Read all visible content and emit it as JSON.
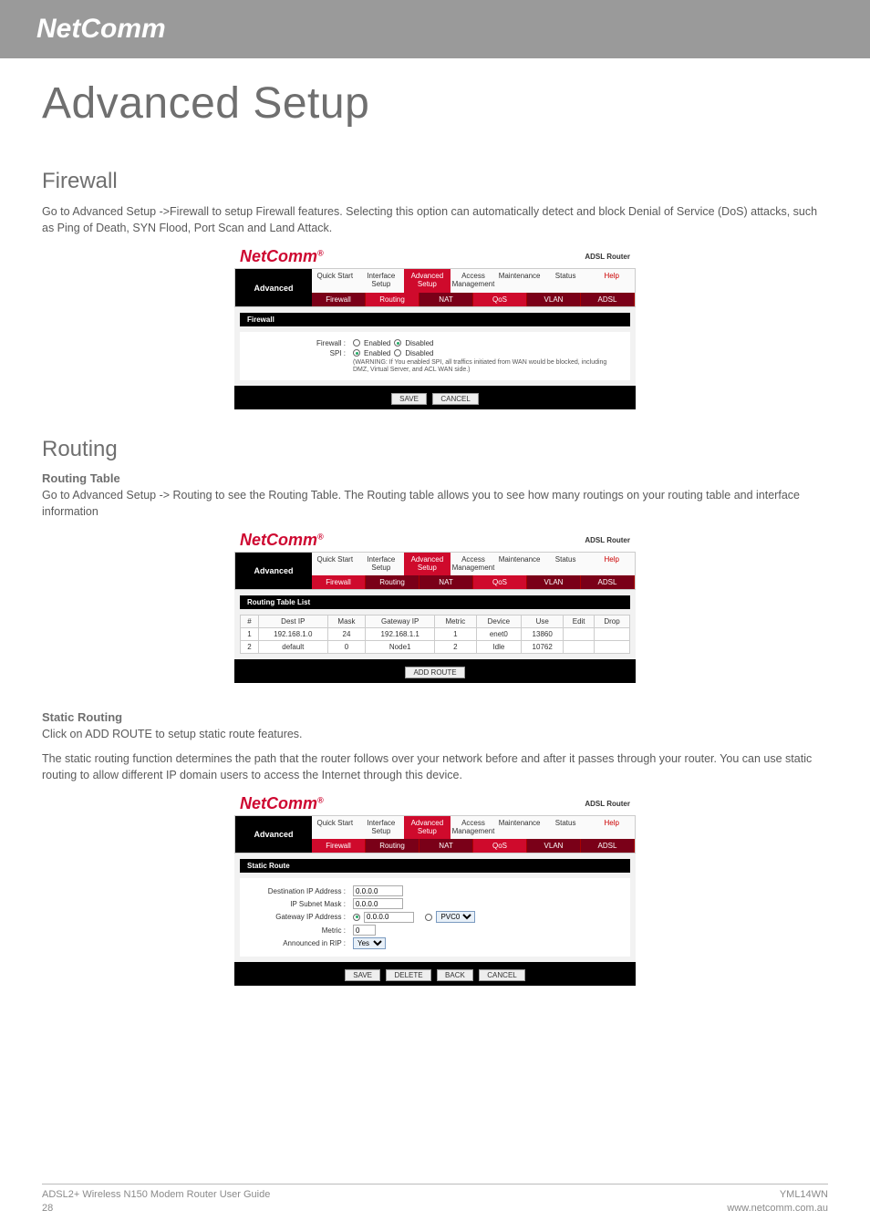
{
  "brand": "NetComm",
  "page_title": "Advanced Setup",
  "firewall": {
    "title": "Firewall",
    "desc": "Go to Advanced Setup ->Firewall to setup Firewall features. Selecting this option can automatically detect and block Denial of Service (DoS) attacks, such as Ping of Death, SYN Flood, Port Scan and Land Attack."
  },
  "ss_common": {
    "logo": "NetComm",
    "reg": "®",
    "adsl": "ADSL Router",
    "left_label": "Advanced",
    "tabs1": [
      "Quick Start",
      "Interface Setup",
      "Advanced Setup",
      "Access Management",
      "Maintenance",
      "Status",
      "Help"
    ],
    "tabs2": [
      "Firewall",
      "Routing",
      "NAT",
      "QoS",
      "VLAN",
      "ADSL"
    ]
  },
  "ss1": {
    "black_bar": "Firewall",
    "row1_lbl": "Firewall :",
    "row1_opt_a": "Enabled",
    "row1_opt_b": "Disabled",
    "row2_lbl": "SPI :",
    "row2_opt_a": "Enabled",
    "row2_opt_b": "Disabled",
    "warn": "(WARNING: If You enabled SPI, all traffics initiated from WAN would be blocked, including DMZ, Virtual Server, and ACL WAN side.)",
    "btn_save": "SAVE",
    "btn_cancel": "CANCEL"
  },
  "routing": {
    "title": "Routing",
    "sub1": "Routing Table",
    "desc1": "Go to Advanced Setup -> Routing to see the Routing Table. The Routing table allows you to see how many routings on your routing table and interface information"
  },
  "ss2": {
    "black_bar": "Routing Table List",
    "headers": [
      "#",
      "Dest IP",
      "Mask",
      "Gateway IP",
      "Metric",
      "Device",
      "Use",
      "Edit",
      "Drop"
    ],
    "rows": [
      [
        "1",
        "192.168.1.0",
        "24",
        "192.168.1.1",
        "1",
        "enet0",
        "13860",
        "",
        ""
      ],
      [
        "2",
        "default",
        "0",
        "Node1",
        "2",
        "Idle",
        "10762",
        "",
        ""
      ]
    ],
    "btn": "ADD ROUTE"
  },
  "static": {
    "sub": "Static Routing",
    "p1": "Click on ADD ROUTE to setup static route features.",
    "p2": "The static routing function determines the path that the router follows over your network before and after it passes through your router. You can use static routing to allow different IP domain users to access the Internet through this device."
  },
  "ss3": {
    "black_bar": "Static Route",
    "f1_lbl": "Destination IP Address :",
    "f1_val": "0.0.0.0",
    "f2_lbl": "IP Subnet Mask :",
    "f2_val": "0.0.0.0",
    "f3_lbl": "Gateway IP Address :",
    "f3_val": "0.0.0.0",
    "f3_sel": "PVC0",
    "f4_lbl": "Metric :",
    "f4_val": "0",
    "f5_lbl": "Announced in RIP :",
    "f5_val": "Yes",
    "btn_save": "SAVE",
    "btn_delete": "DELETE",
    "btn_back": "BACK",
    "btn_cancel": "CANCEL"
  },
  "footer": {
    "left1": "ADSL2+ Wireless N150 Modem Router User Guide",
    "left2": "28",
    "right1": "YML14WN",
    "right2": "www.netcomm.com.au"
  }
}
